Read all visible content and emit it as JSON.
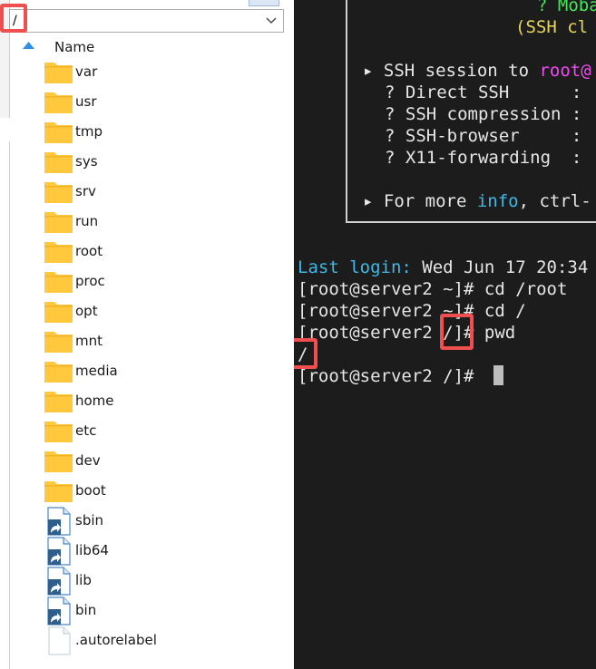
{
  "file_browser": {
    "path": "/",
    "column_header": "Name",
    "items": [
      {
        "name": "var",
        "type": "folder"
      },
      {
        "name": "usr",
        "type": "folder"
      },
      {
        "name": "tmp",
        "type": "folder"
      },
      {
        "name": "sys",
        "type": "folder"
      },
      {
        "name": "srv",
        "type": "folder"
      },
      {
        "name": "run",
        "type": "folder"
      },
      {
        "name": "root",
        "type": "folder"
      },
      {
        "name": "proc",
        "type": "folder"
      },
      {
        "name": "opt",
        "type": "folder"
      },
      {
        "name": "mnt",
        "type": "folder"
      },
      {
        "name": "media",
        "type": "folder"
      },
      {
        "name": "home",
        "type": "folder"
      },
      {
        "name": "etc",
        "type": "folder"
      },
      {
        "name": "dev",
        "type": "folder"
      },
      {
        "name": "boot",
        "type": "folder"
      },
      {
        "name": "sbin",
        "type": "symlink"
      },
      {
        "name": "lib64",
        "type": "symlink"
      },
      {
        "name": "lib",
        "type": "symlink"
      },
      {
        "name": "bin",
        "type": "symlink"
      },
      {
        "name": ".autorelabel",
        "type": "file"
      }
    ],
    "icons": {
      "folder": "folder-icon",
      "symlink": "symlink-file-icon",
      "file": "file-icon",
      "sort": "sort-ascending-icon",
      "dropdown": "chevron-down-icon"
    }
  },
  "terminal": {
    "banner": {
      "line1": "? Moba",
      "line2": "(SSH cl",
      "session_prefix": "▸ SSH session to ",
      "session_user": "root@",
      "rows": [
        {
          "label": "? Direct SSH      :",
          "key": "direct"
        },
        {
          "label": "? SSH compression :",
          "key": "compression"
        },
        {
          "label": "? SSH-browser     :",
          "key": "browser"
        },
        {
          "label": "? X11-forwarding  :",
          "key": "x11"
        }
      ],
      "more_prefix": "▸ For more ",
      "more_info": "info",
      "more_suffix": ", ctrl-"
    },
    "last_login_label": "Last login:",
    "last_login_value": " Wed Jun 17 20:34",
    "lines": [
      "[root@server2 ~]# cd /root",
      "[root@server2 ~]# cd /",
      "[root@server2 /]# pwd",
      "/",
      "[root@server2 /]# "
    ]
  },
  "colors": {
    "annotation": "#ef4f4f",
    "folder": "#ffc83d",
    "terminal_bg": "#1c1c1c",
    "green": "#43e65b",
    "yellow": "#e8d65a",
    "magenta": "#f04bf0",
    "cyan": "#3db8e8"
  }
}
